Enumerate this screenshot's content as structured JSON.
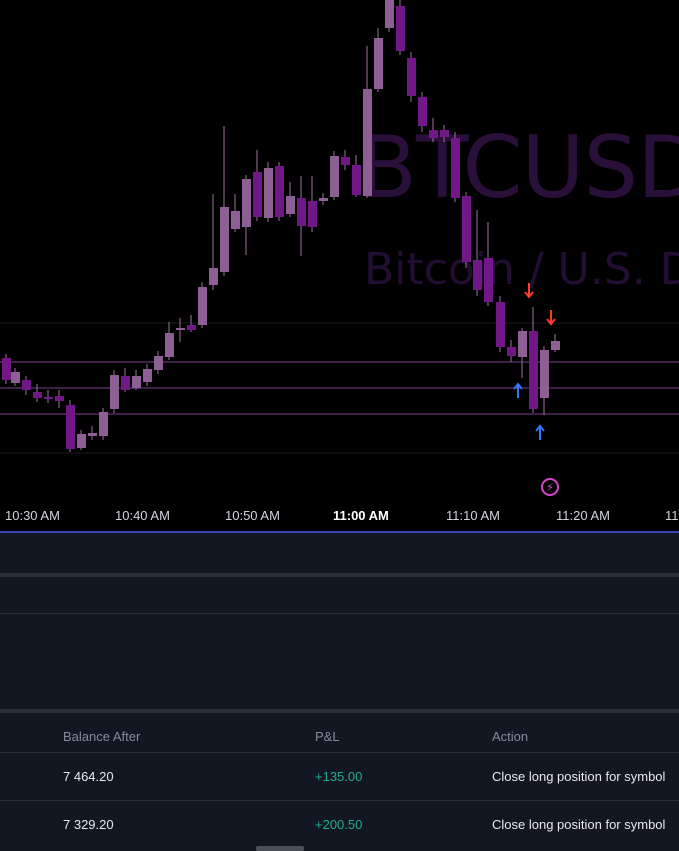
{
  "watermark": {
    "symbol": "BTCUSD",
    "description": "Bitcoin / U.S. D"
  },
  "time_axis": [
    {
      "label": "10:30 AM",
      "bold": false
    },
    {
      "label": "10:40 AM",
      "bold": false
    },
    {
      "label": "10:50 AM",
      "bold": false
    },
    {
      "label": "11:00 AM",
      "bold": true
    },
    {
      "label": "11:10 AM",
      "bold": false
    },
    {
      "label": "11:20 AM",
      "bold": false
    },
    {
      "label": "11",
      "bold": false
    }
  ],
  "colors": {
    "up_candle": "#8e5f95",
    "down_candle": "#721788",
    "wick": "#9a739c",
    "level_line": "#7c3f8e",
    "buy_signal": "#2f78ff",
    "sell_signal": "#ff3b30",
    "pnl_positive": "#22ab94"
  },
  "icons": {
    "bolt_badge": "lightning-bolt-icon",
    "buy_arrow": "arrow-up-icon",
    "sell_arrow": "arrow-down-icon"
  },
  "trades": {
    "columns": {
      "balance": "Balance After",
      "pnl": "P&L",
      "action": "Action"
    },
    "rows": [
      {
        "balance": "7 464.20",
        "pnl": "+135.00",
        "action": "Close long position for symbol"
      },
      {
        "balance": "7 329.20",
        "pnl": "+200.50",
        "action": "Close long position for symbol"
      }
    ]
  }
}
